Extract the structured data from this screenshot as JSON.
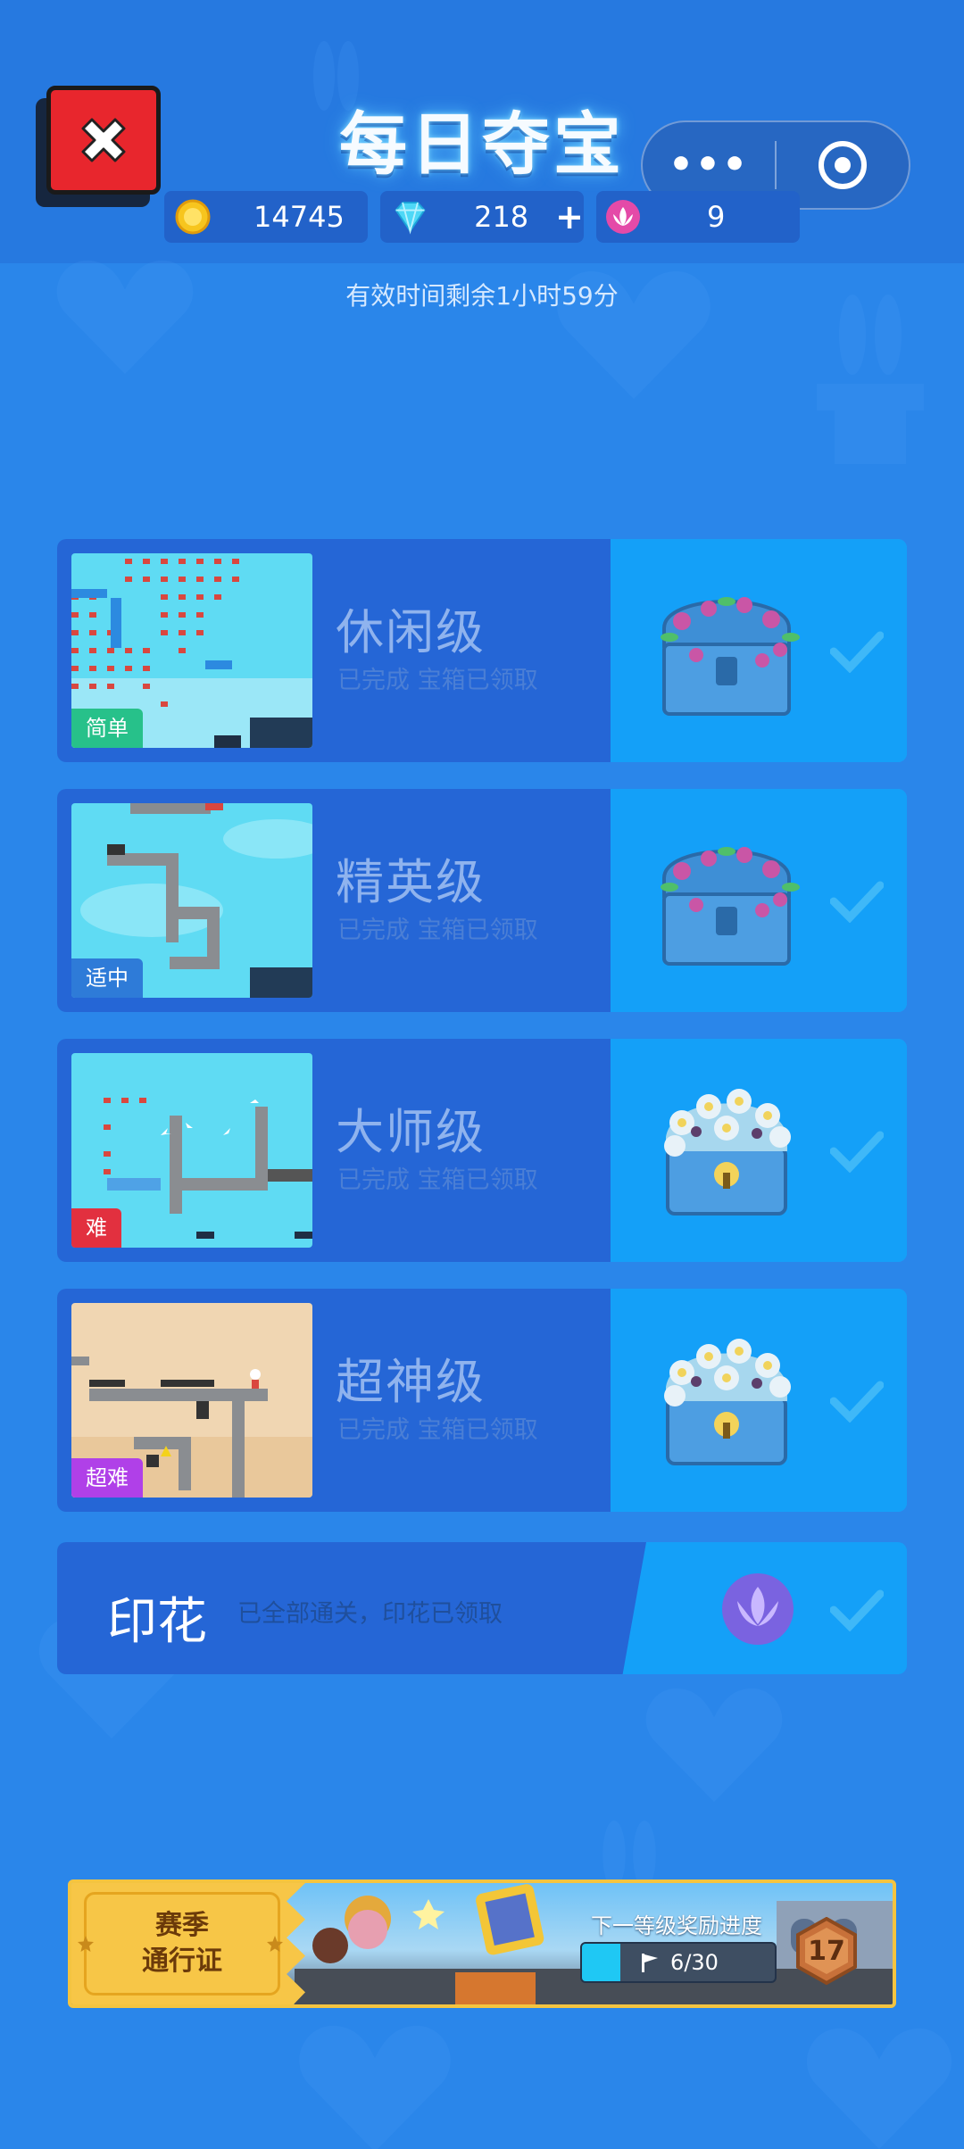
{
  "header": {
    "title": "每日夺宝",
    "menu_dots": "•••",
    "currencies": [
      {
        "icon": "coin-icon",
        "value": "14745"
      },
      {
        "icon": "diamond-icon",
        "value": "218",
        "action": "+"
      },
      {
        "icon": "lotus-icon",
        "value": "9"
      }
    ],
    "remaining_time": "有效时间剩余1小时59分"
  },
  "levels": [
    {
      "name": "休闲级",
      "tag": "简单",
      "tag_color": "#27C18A",
      "status": "已完成 宝箱已领取",
      "chest": "blue-chest-icon"
    },
    {
      "name": "精英级",
      "tag": "适中",
      "tag_color": "#2E7BD8",
      "status": "已完成 宝箱已领取",
      "chest": "blue-chest-icon"
    },
    {
      "name": "大师级",
      "tag": "难",
      "tag_color": "#E2303F",
      "status": "已完成 宝箱已领取",
      "chest": "flower-chest-icon"
    },
    {
      "name": "超神级",
      "tag": "超难",
      "tag_color": "#B040E8",
      "status": "已完成 宝箱已领取",
      "chest": "flower-chest-icon"
    }
  ],
  "stamp": {
    "label": "印花",
    "message": "已全部通关，印花已领取"
  },
  "season_pass": {
    "title_line1": "赛季",
    "title_line2": "通行证",
    "next_reward_label": "下一等级奖励进度",
    "progress_text": "6/30",
    "progress_fraction": 0.2,
    "level": "17"
  },
  "colors": {
    "background": "#2A86EA",
    "card_left": "#2566D6",
    "card_right": "#14A0F8",
    "accent_gold": "#F4C440"
  }
}
